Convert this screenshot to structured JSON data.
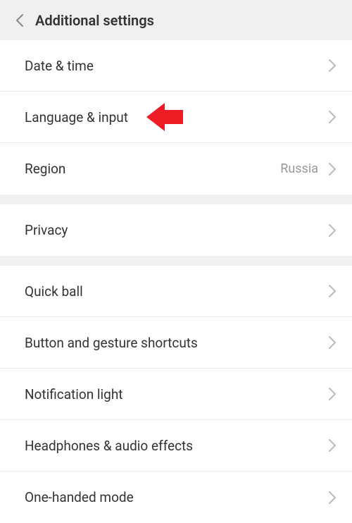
{
  "header": {
    "title": "Additional settings"
  },
  "groups": [
    {
      "rows": [
        {
          "label": "Date & time",
          "value": "",
          "highlight": false
        },
        {
          "label": "Language & input",
          "value": "",
          "highlight": true
        },
        {
          "label": "Region",
          "value": "Russia",
          "highlight": false
        }
      ]
    },
    {
      "rows": [
        {
          "label": "Privacy",
          "value": "",
          "highlight": false
        }
      ]
    },
    {
      "rows": [
        {
          "label": "Quick ball",
          "value": "",
          "highlight": false
        },
        {
          "label": "Button and gesture shortcuts",
          "value": "",
          "highlight": false
        },
        {
          "label": "Notification light",
          "value": "",
          "highlight": false
        },
        {
          "label": "Headphones & audio effects",
          "value": "",
          "highlight": false
        },
        {
          "label": "One-handed mode",
          "value": "",
          "highlight": false
        }
      ]
    }
  ]
}
